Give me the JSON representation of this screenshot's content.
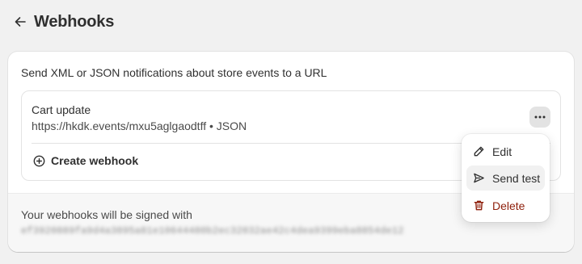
{
  "page": {
    "title": "Webhooks"
  },
  "intro": "Send XML or JSON notifications about store events to a URL",
  "webhook": {
    "name": "Cart update",
    "url": "https://hkdk.events/mxu5aglgaodtff",
    "separator": "•",
    "format": "JSON"
  },
  "create_label": "Create webhook",
  "signing": {
    "label": "Your webhooks will be signed with",
    "secret": "ef3920889fa9d4a3895a81e10644480b2ec32032ae42c4dea9399eba8854de12"
  },
  "menu": {
    "items": [
      {
        "label": "Edit",
        "icon": "pencil-icon"
      },
      {
        "label": "Send test",
        "icon": "send-icon"
      },
      {
        "label": "Delete",
        "icon": "trash-icon"
      }
    ]
  },
  "colors": {
    "danger": "#8e1f0b",
    "background": "#f1f1f1",
    "card": "#ffffff"
  }
}
